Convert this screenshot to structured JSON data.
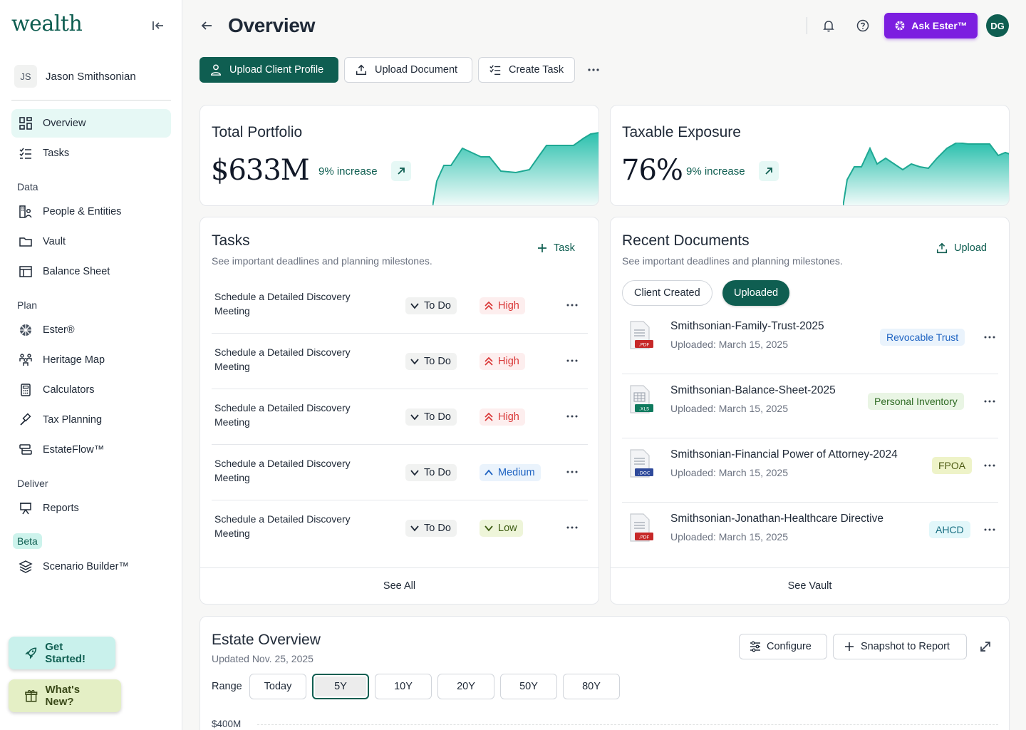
{
  "app": {
    "logo": "wealth"
  },
  "sidebar": {
    "client": {
      "initials": "JS",
      "name": "Jason Smithsonian"
    },
    "top_items": [
      {
        "label": "Overview",
        "icon": "grid-icon",
        "active": true
      },
      {
        "label": "Tasks",
        "icon": "checklist-icon"
      }
    ],
    "sections": [
      {
        "label": "Data",
        "items": [
          {
            "label": "People & Entities",
            "icon": "people-icon"
          },
          {
            "label": "Vault",
            "icon": "folder-icon"
          },
          {
            "label": "Balance Sheet",
            "icon": "table-icon"
          }
        ]
      },
      {
        "label": "Plan",
        "items": [
          {
            "label": "Ester®",
            "icon": "ester-icon"
          },
          {
            "label": "Heritage Map",
            "icon": "family-icon"
          },
          {
            "label": "Calculators",
            "icon": "calculator-icon"
          },
          {
            "label": "Tax Planning",
            "icon": "gavel-icon"
          },
          {
            "label": "EstateFlow™",
            "icon": "flow-icon"
          }
        ]
      },
      {
        "label": "Deliver",
        "items": [
          {
            "label": "Reports",
            "icon": "presentation-icon"
          }
        ]
      }
    ],
    "beta_label": "Beta",
    "beta_item": {
      "label": "Scenario Builder™",
      "icon": "layers-icon"
    },
    "get_started": "Get Started!",
    "whats_new": "What's New?"
  },
  "header": {
    "title": "Overview",
    "ask_button": "Ask Ester™",
    "user_initials": "DG"
  },
  "actions": {
    "upload_profile": "Upload Client Profile",
    "upload_document": "Upload Document",
    "create_task": "Create Task"
  },
  "portfolio": {
    "title": "Total Portfolio",
    "value": "$633M",
    "change": "9% increase"
  },
  "taxable": {
    "title": "Taxable Exposure",
    "value": "76%",
    "change": "9% increase"
  },
  "tasks_card": {
    "title": "Tasks",
    "subtitle": "See important deadlines and planning milestones.",
    "add_label": "Task",
    "rows": [
      {
        "name": "Schedule a Detailed Discovery Meeting",
        "status": "To Do",
        "priority": "High"
      },
      {
        "name": "Schedule a Detailed Discovery Meeting",
        "status": "To Do",
        "priority": "High"
      },
      {
        "name": "Schedule a Detailed Discovery Meeting",
        "status": "To Do",
        "priority": "High"
      },
      {
        "name": "Schedule a Detailed Discovery Meeting",
        "status": "To Do",
        "priority": "Medium"
      },
      {
        "name": "Schedule a Detailed Discovery Meeting",
        "status": "To Do",
        "priority": "Low"
      }
    ],
    "footer": "See All"
  },
  "docs_card": {
    "title": "Recent Documents",
    "subtitle": "See important deadlines and planning milestones.",
    "upload_label": "Upload",
    "tabs": [
      "Client Created",
      "Uploaded"
    ],
    "rows": [
      {
        "name": "Smithsonian-Family-Trust-2025",
        "date": "Uploaded: March 15, 2025",
        "tag": "Revocable Trust",
        "type": ".PDF"
      },
      {
        "name": "Smithsonian-Balance-Sheet-2025",
        "date": "Uploaded: March 15, 2025",
        "tag": "Personal Inventory",
        "type": ".XLS"
      },
      {
        "name": "Smithsonian-Financial Power of Attorney-2024",
        "date": "Uploaded: March 15, 2025",
        "tag": "FPOA",
        "type": ".DOC"
      },
      {
        "name": "Smithsonian-Jonathan-Healthcare Directive",
        "date": "Uploaded: March 15, 2025",
        "tag": "AHCD",
        "type": ".PDF"
      }
    ],
    "footer": "See Vault"
  },
  "estate": {
    "title": "Estate Overview",
    "updated": "Updated Nov. 25, 2025",
    "configure": "Configure",
    "snapshot": "Snapshot to Report",
    "range_label": "Range",
    "ranges": [
      "Today",
      "5Y",
      "10Y",
      "20Y",
      "50Y",
      "80Y"
    ],
    "selected_range": "5Y",
    "y_top_label": "$400M"
  },
  "colors": {
    "brand": "#0f5e51",
    "accent": "#7c1ee0",
    "teal": "#2bc0ad"
  }
}
